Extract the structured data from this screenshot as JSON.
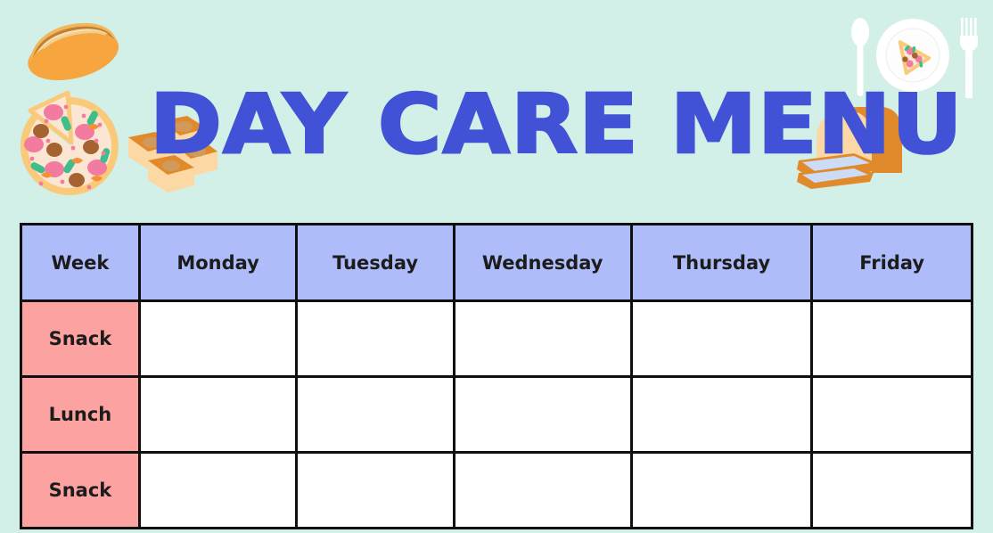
{
  "page": {
    "title": "DAY CARE MENU",
    "background_color": "#d2f0e7",
    "title_color": "#4152d6"
  },
  "decorations": [
    {
      "name": "hotdog-bun-icon",
      "label": "hotdog bun"
    },
    {
      "name": "pizza-icon",
      "label": "pizza with slice removed"
    },
    {
      "name": "bread-rolls-icon",
      "label": "bread rolls"
    },
    {
      "name": "spoon-icon",
      "label": "spoon"
    },
    {
      "name": "plate-pizza-slice-icon",
      "label": "plate with pizza slice"
    },
    {
      "name": "fork-icon",
      "label": "fork"
    },
    {
      "name": "bread-loaf-sandwich-icon",
      "label": "bread loaf and sandwich"
    }
  ],
  "table": {
    "header_bg": "#aebcfa",
    "rowlabel_bg": "#fca3a1",
    "cell_bg": "#ffffff",
    "border_color": "#101010",
    "columns": [
      {
        "key": "week",
        "label": "Week"
      },
      {
        "key": "monday",
        "label": "Monday"
      },
      {
        "key": "tuesday",
        "label": "Tuesday"
      },
      {
        "key": "wednesday",
        "label": "Wednesday"
      },
      {
        "key": "thursday",
        "label": "Thursday"
      },
      {
        "key": "friday",
        "label": "Friday"
      }
    ],
    "rows": [
      {
        "label": "Snack",
        "cells": [
          "",
          "",
          "",
          "",
          ""
        ]
      },
      {
        "label": "Lunch",
        "cells": [
          "",
          "",
          "",
          "",
          ""
        ]
      },
      {
        "label": "Snack",
        "cells": [
          "",
          "",
          "",
          "",
          ""
        ]
      }
    ]
  }
}
